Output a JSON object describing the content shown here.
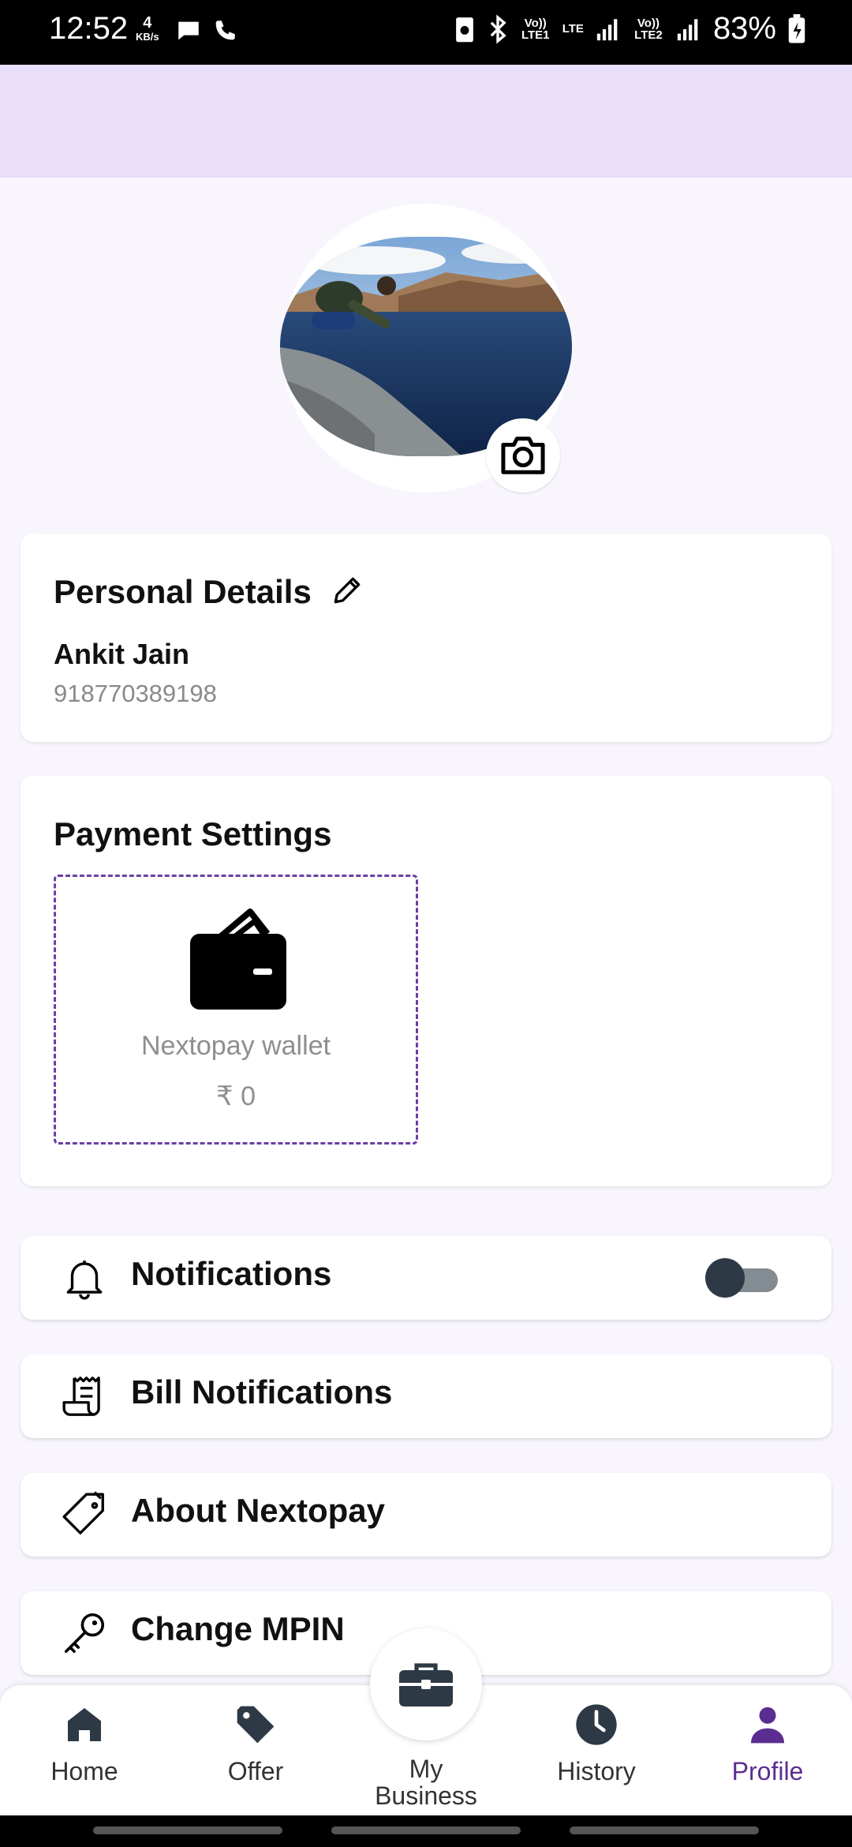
{
  "status_bar": {
    "time": "12:52",
    "data_speed": "4",
    "data_unit": "KB/s",
    "sim1": "Vo)) LTE1",
    "lte": "LTE",
    "sim2": "Vo)) LTE2",
    "battery": "83%"
  },
  "profile": {
    "avatar_icon": "profile-photo",
    "camera_icon": "camera-icon"
  },
  "personal_details": {
    "title": "Personal Details",
    "name": "Ankit Jain",
    "phone": "918770389198"
  },
  "payment_settings": {
    "title": "Payment Settings",
    "wallet_label": "Nextopay wallet",
    "wallet_amount": "₹ 0"
  },
  "menu": {
    "notifications": "Notifications",
    "notifications_enabled": false,
    "bill_notifications": "Bill Notifications",
    "about": "About Nextopay",
    "change_mpin": "Change MPIN"
  },
  "bottom_nav": {
    "home": "Home",
    "offer": "Offer",
    "my_business_line1": "My",
    "my_business_line2": "Business",
    "history": "History",
    "profile": "Profile",
    "active": "profile"
  },
  "colors": {
    "accent": "#5c2d91",
    "header_band": "#e9dffb",
    "background": "#f8f5fd"
  }
}
